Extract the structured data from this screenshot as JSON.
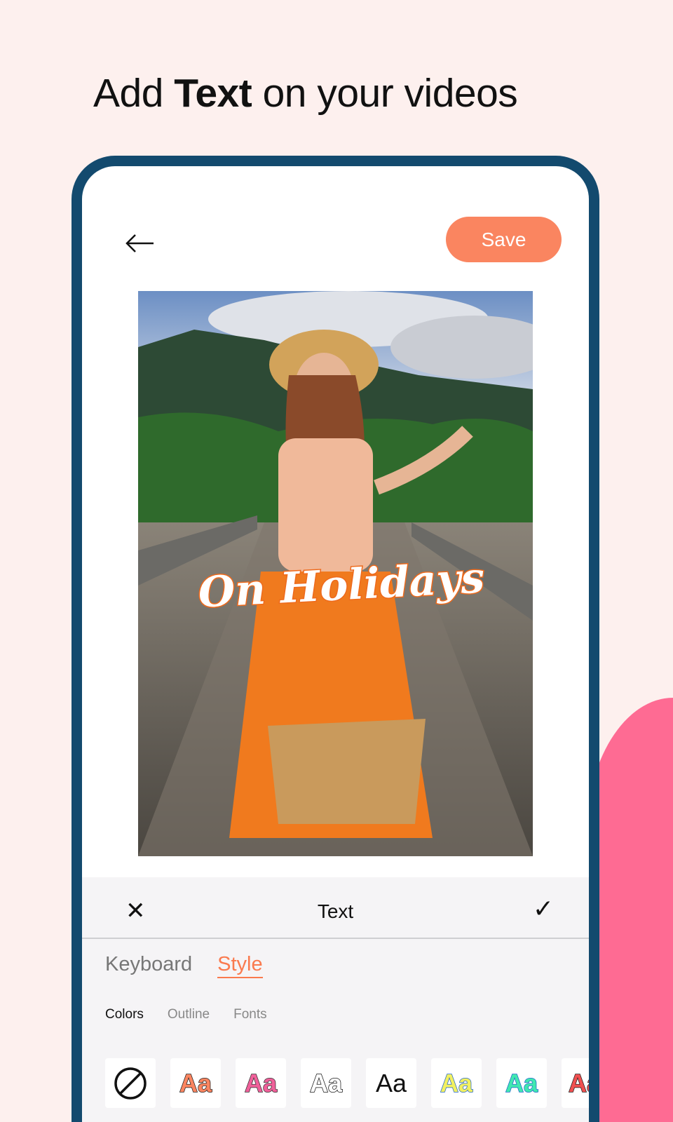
{
  "headline": {
    "pre": "Add ",
    "bold": "Text",
    "post": " on your videos"
  },
  "header": {
    "save_label": "Save"
  },
  "photo": {
    "overlay_text": "On Holidays"
  },
  "toolbar": {
    "title": "Text",
    "close": "✕",
    "confirm": "✓"
  },
  "tabs": [
    {
      "label": "Keyboard"
    },
    {
      "label": "Style",
      "active": true
    }
  ],
  "subtabs": [
    {
      "label": "Colors",
      "active": true
    },
    {
      "label": "Outline"
    },
    {
      "label": "Fonts"
    }
  ],
  "styles": [
    {
      "label": "",
      "icon": "none-icon"
    },
    {
      "label": "Aa",
      "fill": "#fa8560",
      "stroke": "#222"
    },
    {
      "label": "Aa",
      "fill": "#f0609a",
      "stroke": "#333"
    },
    {
      "label": "Aa",
      "fill": "#ffffff",
      "stroke": "#111"
    },
    {
      "label": "Aa",
      "fill": "#111111",
      "stroke": "none"
    },
    {
      "label": "Aa",
      "fill": "#f2f060",
      "stroke": "#2266cc"
    },
    {
      "label": "Aa",
      "fill": "#40e8b0",
      "stroke": "#2266cc"
    },
    {
      "label": "Aa",
      "fill": "#f05050",
      "stroke": "#222"
    }
  ],
  "colors": {
    "accent": "#fa8560",
    "frame": "#134a6e",
    "pink": "#fe6b93",
    "background": "#fdf0ee"
  }
}
